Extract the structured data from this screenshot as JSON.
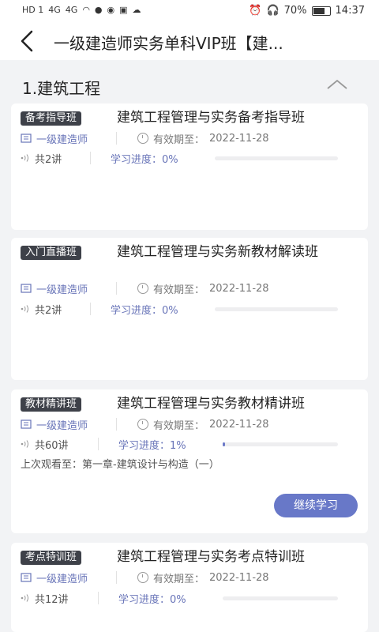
{
  "status": {
    "left_icons": [
      "HD 1",
      "HD 2",
      "4G",
      "4G",
      "wifi",
      "app",
      "qq",
      "app",
      "app"
    ],
    "battery": "70%",
    "time": "14:37"
  },
  "header": {
    "title": "一级建造师实务单科VIP班【建..."
  },
  "section": {
    "title": "1.建筑工程"
  },
  "courses": [
    {
      "badge": "备考指导班",
      "title": "建筑工程管理与实务备考指导班",
      "category": "一级建造师",
      "expiry_label": "有效期至：",
      "expiry": "2022-11-28",
      "lectures": "共2讲",
      "progress_label": "学习进度：",
      "progress": "0%",
      "progress_value": 0
    },
    {
      "badge": "入门直播班",
      "title": "建筑工程管理与实务新教材解读班",
      "category": "一级建造师",
      "expiry_label": "有效期至：",
      "expiry": "2022-11-28",
      "lectures": "共2讲",
      "progress_label": "学习进度：",
      "progress": "0%",
      "progress_value": 0
    },
    {
      "badge": "教材精讲班",
      "title": "建筑工程管理与实务教材精讲班",
      "category": "一级建造师",
      "expiry_label": "有效期至：",
      "expiry": "2022-11-28",
      "lectures": "共60讲",
      "progress_label": "学习进度：",
      "progress": "1%",
      "progress_value": 0.01,
      "last_watched": "上次观看至：第一章-建筑设计与构造（一）",
      "continue_label": "继续学习"
    },
    {
      "badge": "考点特训班",
      "title": "建筑工程管理与实务考点特训班",
      "category": "一级建造师",
      "expiry_label": "有效期至：",
      "expiry": "2022-11-28",
      "lectures": "共12讲",
      "progress_label": "学习进度：",
      "progress": "0%",
      "progress_value": 0
    }
  ],
  "colors": {
    "accent": "#6878c8",
    "badge_bg": "#3e4149",
    "background": "#f2f3f5"
  }
}
